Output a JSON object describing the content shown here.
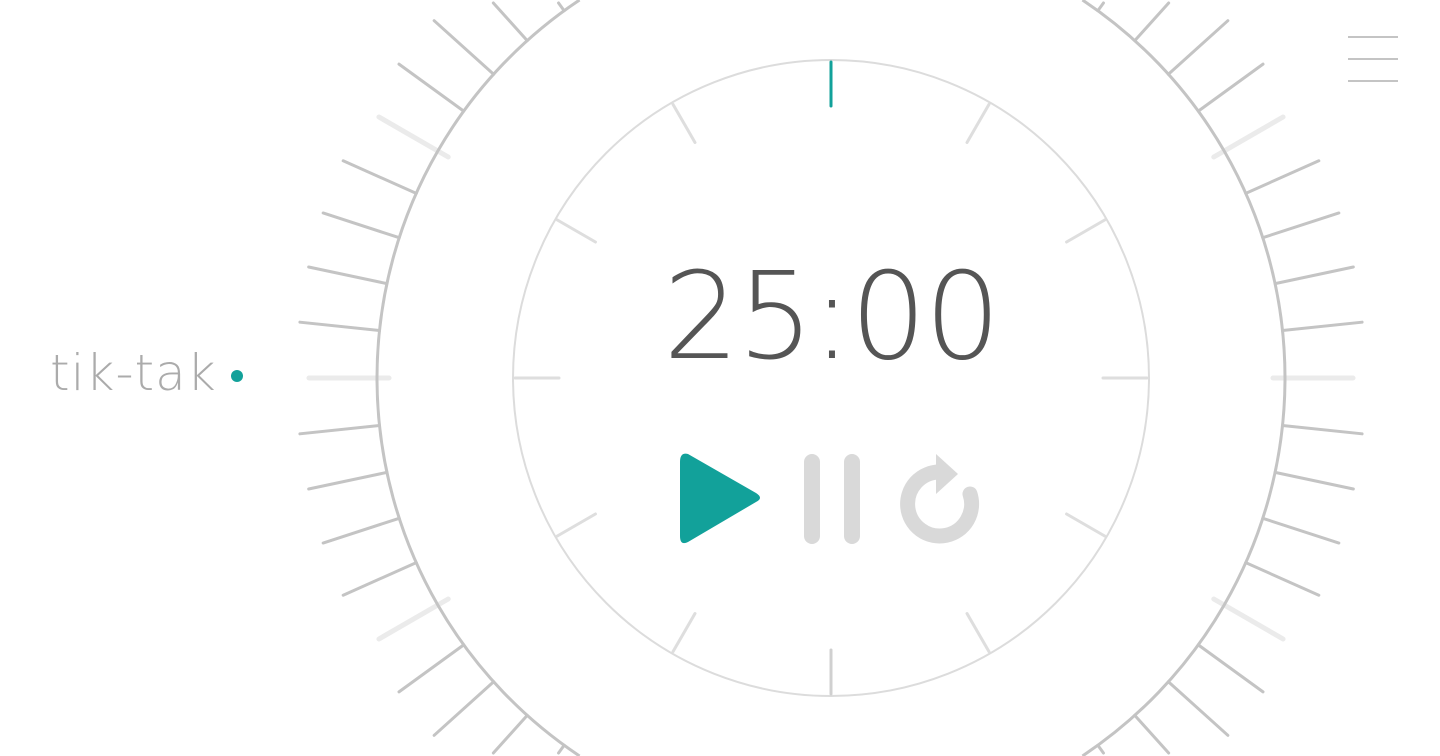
{
  "brand": {
    "name": "tik-tak",
    "dot_color": "#12a19a"
  },
  "timer": {
    "display": "25:00",
    "progress_fraction": 0
  },
  "controls": [
    {
      "name": "play",
      "icon": "play-icon",
      "color": "#12a19a"
    },
    {
      "name": "pause",
      "icon": "pause-icon",
      "color": "#d9d9d9"
    },
    {
      "name": "reset",
      "icon": "reset-icon",
      "color": "#d9d9d9"
    }
  ],
  "menu": {
    "icon": "hamburger-menu-icon"
  },
  "colors": {
    "accent": "#12a19a",
    "tick": "#c4c4c4",
    "tick_light": "#ebebeb",
    "inner_tick": "#dedede",
    "text": "#555555"
  }
}
